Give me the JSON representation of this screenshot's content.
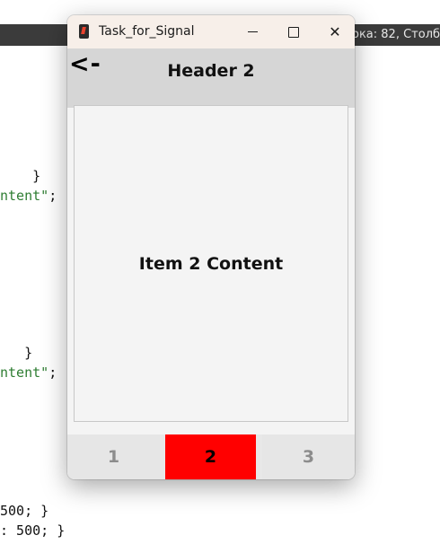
{
  "background": {
    "status_text": "ока: 82, Столб",
    "code_lines": [
      {
        "pre": "    }",
        "str": "",
        "post": ""
      },
      {
        "pre": "",
        "str": "ntent\"",
        "post": ";"
      },
      {
        "pre": "   }",
        "str": "",
        "post": ""
      },
      {
        "pre": "",
        "str": "ntent\"",
        "post": ";"
      },
      {
        "pre": "500; }",
        "str": "",
        "post": ""
      },
      {
        "pre": ": 500; }",
        "str": "",
        "post": ""
      }
    ]
  },
  "window": {
    "title": "Task_for_Signal",
    "controls": {
      "minimize": "minimize",
      "maximize": "maximize",
      "close": "✕"
    }
  },
  "header": {
    "back_label": "<-",
    "title": "Header 2"
  },
  "content": {
    "text": "Item 2 Content"
  },
  "tabs": [
    {
      "label": "1",
      "selected": false
    },
    {
      "label": "2",
      "selected": true
    },
    {
      "label": "3",
      "selected": false
    }
  ],
  "colors": {
    "selected_tab": "#ff0000",
    "header_bg": "#d6d6d6",
    "titlebar_bg": "#f7efe9"
  }
}
